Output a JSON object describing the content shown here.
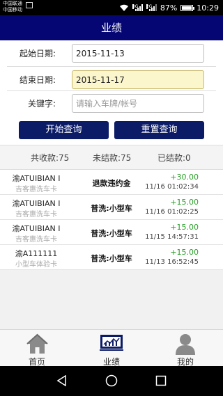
{
  "status_bar": {
    "carrier1": "中国联通",
    "carrier2": "中国移动",
    "net1": "3G",
    "net2": "2G",
    "battery": "87%",
    "battery_level": 0.87,
    "time": "10:29"
  },
  "header": {
    "title": "业绩"
  },
  "form": {
    "start_label": "起始日期:",
    "start_value": "2015-11-13",
    "end_label": "结束日期:",
    "end_value": "2015-11-17",
    "keyword_label": "关键字:",
    "keyword_value": "",
    "keyword_placeholder": "请输入车牌/帐号"
  },
  "buttons": {
    "query": "开始查询",
    "reset": "重置查询"
  },
  "summary": {
    "total": "共收款:75",
    "unsettled": "未结款:75",
    "settled": "已结款:0"
  },
  "records": [
    {
      "plate": "渝ATUIBIAN I",
      "card": "吉客惠洗车卡",
      "type": "退款违约金",
      "amount": "+30.00",
      "time": "11/16 01:02:34"
    },
    {
      "plate": "渝ATUIBIAN I",
      "card": "吉客惠洗车卡",
      "type": "普洗:小型车",
      "amount": "+15.00",
      "time": "11/16 01:02:25"
    },
    {
      "plate": "渝ATUIBIAN I",
      "card": "吉客惠洗车卡",
      "type": "普洗:小型车",
      "amount": "+15.00",
      "time": "11/15 14:57:31"
    },
    {
      "plate": "渝A111111",
      "card": "小型车体验卡",
      "type": "普洗:小型车",
      "amount": "+15.00",
      "time": "11/13 16:52:45"
    }
  ],
  "nav": {
    "home": "首页",
    "performance": "业绩",
    "mine": "我的"
  },
  "colors": {
    "header_bg": "#050673",
    "button_bg": "#0b1b66",
    "amount_green": "#2aa02a",
    "active_field": "#fbf6cc"
  },
  "icons": {
    "home": "house-icon",
    "performance": "chart-board-icon",
    "mine": "person-icon"
  }
}
